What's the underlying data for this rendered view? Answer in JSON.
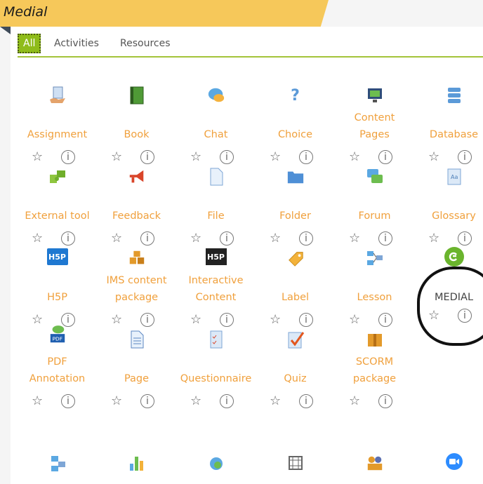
{
  "header": {
    "title": "Medial"
  },
  "tabs": [
    {
      "label": "All"
    },
    {
      "label": "Activities"
    },
    {
      "label": "Resources"
    }
  ],
  "activities": [
    {
      "name": "Assignment",
      "icon": "assignment-icon"
    },
    {
      "name": "Book",
      "icon": "book-icon"
    },
    {
      "name": "Chat",
      "icon": "chat-icon"
    },
    {
      "name": "Choice",
      "icon": "choice-icon"
    },
    {
      "name": "Content Pages",
      "icon": "content-pages-icon"
    },
    {
      "name": "Database",
      "icon": "database-icon"
    },
    {
      "name": "External tool",
      "icon": "external-tool-icon"
    },
    {
      "name": "Feedback",
      "icon": "feedback-icon"
    },
    {
      "name": "File",
      "icon": "file-icon"
    },
    {
      "name": "Folder",
      "icon": "folder-icon"
    },
    {
      "name": "Forum",
      "icon": "forum-icon"
    },
    {
      "name": "Glossary",
      "icon": "glossary-icon"
    },
    {
      "name": "H5P",
      "icon": "h5p-icon"
    },
    {
      "name": "IMS content package",
      "icon": "ims-package-icon"
    },
    {
      "name": "Interactive Content",
      "icon": "interactive-content-icon"
    },
    {
      "name": "Label",
      "icon": "label-icon"
    },
    {
      "name": "Lesson",
      "icon": "lesson-icon"
    },
    {
      "name": "MEDIAL",
      "icon": "medial-icon"
    },
    {
      "name": "PDF Annotation",
      "icon": "pdf-annotation-icon"
    },
    {
      "name": "Page",
      "icon": "page-icon"
    },
    {
      "name": "Questionnaire",
      "icon": "questionnaire-icon"
    },
    {
      "name": "Quiz",
      "icon": "quiz-icon"
    },
    {
      "name": "SCORM package",
      "icon": "scorm-icon"
    }
  ],
  "icon_text": {
    "h5p": "H5P",
    "pdf": "PDF"
  },
  "colors": {
    "accent": "#8fbc1a",
    "label_text": "#f0a03c",
    "ribbon": "#f6c85a"
  }
}
